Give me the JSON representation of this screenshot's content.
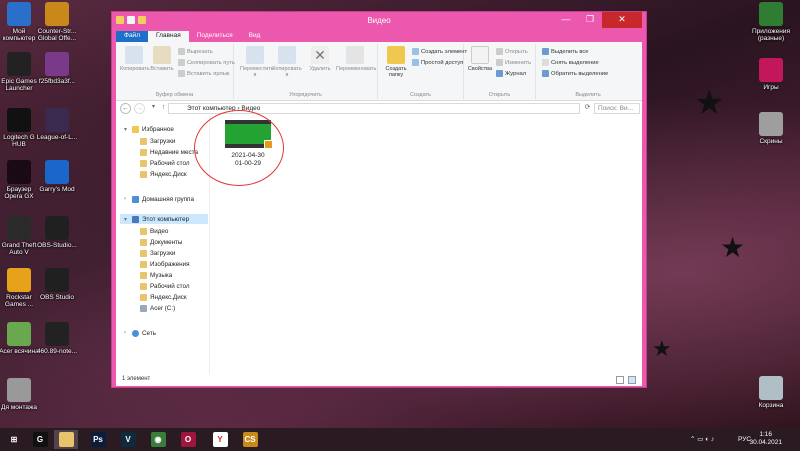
{
  "window": {
    "title": "Видео",
    "minimize": "—",
    "maximize": "❐",
    "close": "✕"
  },
  "tabs": [
    "Файл",
    "Главная",
    "Поделиться",
    "Вид"
  ],
  "ribbon": {
    "clipboard": {
      "name": "Буфер обмена",
      "copy": "Копировать",
      "paste": "Вставить",
      "cut": "Вырезать",
      "copy_path": "Скопировать путь",
      "paste_shortcut": "Вставить ярлык"
    },
    "organize": {
      "name": "Упорядочить",
      "move_to": "Переместить в",
      "copy_to": "Копировать в",
      "delete": "Удалить",
      "rename": "Переименовать"
    },
    "new": {
      "name": "Создать",
      "new_folder": "Создать папку",
      "new_item": "Создать элемент",
      "easy_access": "Простой доступ"
    },
    "open": {
      "name": "Открыть",
      "properties": "Свойства",
      "open": "Открыть",
      "edit": "Изменить",
      "history": "Журнал"
    },
    "select": {
      "name": "Выделить",
      "select_all": "Выделить все",
      "select_none": "Снять выделение",
      "invert": "Обратить выделение"
    }
  },
  "address": {
    "path": "Этот компьютер  ›  Видео",
    "search_placeholder": "Поиск: Ви..."
  },
  "navpane": {
    "favorites": "Избранное",
    "fav_items": [
      "Загрузки",
      "Недавние места",
      "Рабочий стол",
      "Яндекс.Диск"
    ],
    "homegroup": "Домашняя группа",
    "this_pc": "Этот компьютер",
    "pc_items": [
      "Видео",
      "Документы",
      "Загрузки",
      "Изображения",
      "Музыка",
      "Рабочий стол",
      "Яндекс.Диск",
      "Acer (C:)"
    ],
    "network": "Сеть"
  },
  "content": {
    "file": {
      "name_line1": "2021-04-30",
      "name_line2": "01-00-29"
    }
  },
  "status": {
    "count": "1 элемент"
  },
  "desktop_left": [
    {
      "label": "Мой компьютер",
      "icon": "computer-icon",
      "color": "#2a6fc9"
    },
    {
      "label": "Counter-Str... Global Offe...",
      "icon": "csgo-icon",
      "color": "#c9881a"
    },
    {
      "label": "Epic Games Launcher",
      "icon": "epic-games-icon",
      "color": "#222222"
    },
    {
      "label": "f25fbd3a3f...",
      "icon": "image-icon",
      "color": "#7a3a8a"
    },
    {
      "label": "Logitech G HUB",
      "icon": "logitech-icon",
      "color": "#111111"
    },
    {
      "label": "League-of-L...",
      "icon": "league-icon",
      "color": "#3a2a50"
    },
    {
      "label": "Браузер Opera GX",
      "icon": "opera-gx-icon",
      "color": "#1a0a14"
    },
    {
      "label": "Garry's Mod",
      "icon": "gmod-icon",
      "color": "#1b66c9"
    },
    {
      "label": "Grand Theft Auto V",
      "icon": "gta-icon",
      "color": "#2a2a2a"
    },
    {
      "label": "OBS-Studio...",
      "icon": "obs-icon",
      "color": "#202020"
    },
    {
      "label": "Rockstar Games ...",
      "icon": "rockstar-icon",
      "color": "#e6a21a"
    },
    {
      "label": "OBS Studio",
      "icon": "obs-icon",
      "color": "#202020"
    },
    {
      "label": "Acer всячина",
      "icon": "folder-icon",
      "color": "#6aa84f"
    },
    {
      "label": "460.89-note...",
      "icon": "nvidia-icon",
      "color": "#222222"
    },
    {
      "label": "Дя монтажа",
      "icon": "disc-icon",
      "color": "#999999"
    }
  ],
  "desktop_right": [
    {
      "label": "Приложения (разные)",
      "icon": "tree-icon",
      "color": "#2e7d32"
    },
    {
      "label": "Игры",
      "icon": "games-icon",
      "color": "#c2185b"
    },
    {
      "label": "Скрины",
      "icon": "camera-icon",
      "color": "#9e9e9e"
    },
    {
      "label": "Корзина",
      "icon": "recycle-bin-icon",
      "color": "#b0bec5"
    }
  ],
  "taskbar": {
    "apps": [
      {
        "icon": "windows-start-icon",
        "glyph": "⊞",
        "color": "#2a1a22"
      },
      {
        "icon": "logitech-icon",
        "glyph": "G",
        "color": "#111111"
      },
      {
        "icon": "file-explorer-icon",
        "glyph": "",
        "color": "#e8c46a"
      },
      {
        "icon": "photoshop-icon",
        "glyph": "Ps",
        "color": "#0b1d3a"
      },
      {
        "icon": "vegas-icon",
        "glyph": "V",
        "color": "#0f2a3c"
      },
      {
        "icon": "chrome-icon",
        "glyph": "◉",
        "color": "#3a7d3a"
      },
      {
        "icon": "opera-gx-icon",
        "glyph": "O",
        "color": "#a0153e"
      },
      {
        "icon": "yandex-browser-icon",
        "glyph": "Y",
        "color": "#ffffff"
      },
      {
        "icon": "csgo-icon",
        "glyph": "CS",
        "color": "#c9881a"
      }
    ],
    "lang": "РУС",
    "time": "1:16",
    "date": "30.04.2021"
  }
}
